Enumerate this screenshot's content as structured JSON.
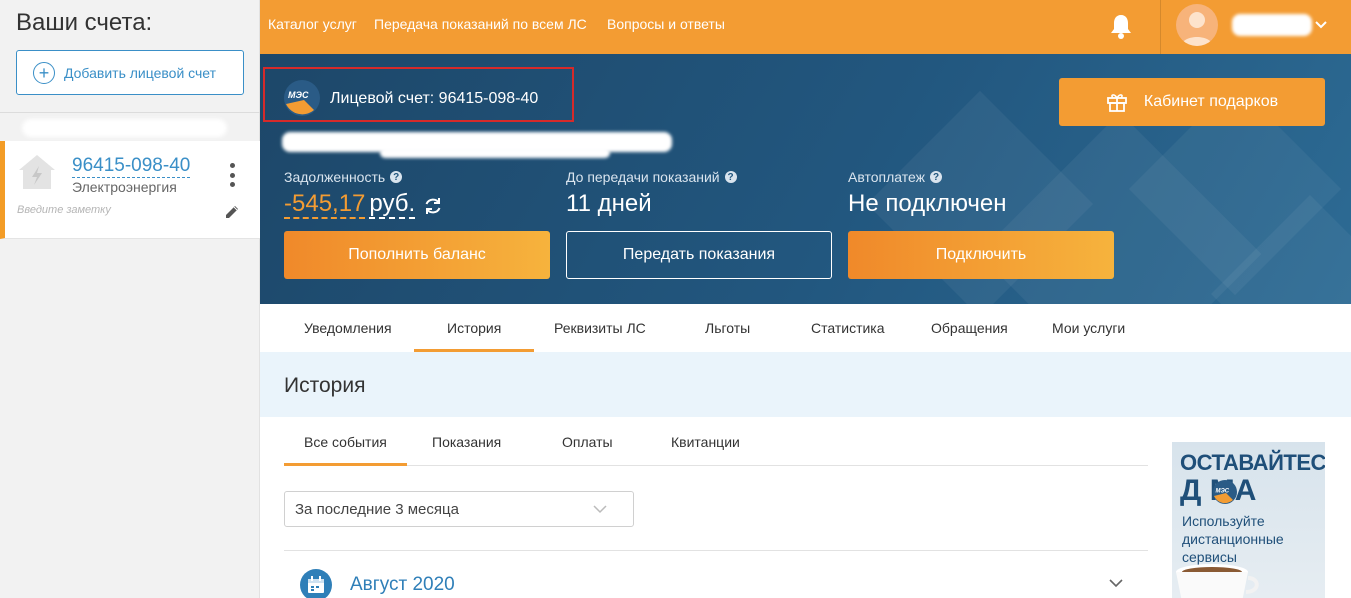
{
  "sidebar": {
    "title": "Ваши счета:",
    "add_button": "Добавить лицевой счет",
    "account": {
      "number": "96415-098-40",
      "type": "Электроэнергия",
      "note_placeholder": "Введите заметку"
    }
  },
  "topnav": {
    "links": [
      "Каталог услуг",
      "Передача показаний по всем ЛС",
      "Вопросы и ответы"
    ]
  },
  "hero": {
    "logo_text": "МЭС",
    "account_label": "Лицевой счет: 96415-098-40",
    "gift_button": "Кабинет подарков",
    "debt": {
      "label": "Задолженность",
      "value": "-545,17",
      "currency": "руб."
    },
    "readings": {
      "label": "До передачи показаний",
      "value": "11 дней"
    },
    "autopay": {
      "label": "Автоплатеж",
      "value": "Не подключен"
    },
    "buttons": {
      "topup": "Пополнить баланс",
      "submit": "Передать показания",
      "connect": "Подключить"
    }
  },
  "tabs": [
    "Уведомления",
    "История",
    "Реквизиты ЛС",
    "Льготы",
    "Статистика",
    "Обращения",
    "Мои услуги"
  ],
  "active_tab": "История",
  "history": {
    "title": "История",
    "subtabs": [
      "Все события",
      "Показания",
      "Оплаты",
      "Квитанции"
    ],
    "period": "За последние 3 месяца",
    "month": "Август 2020"
  },
  "promo": {
    "line1": "ОСТАВАЙТЕСЬ",
    "line2": "Д МА",
    "logo_text": "МЭС",
    "sub": [
      "Используйте",
      "дистанционные",
      "сервисы"
    ]
  },
  "colors": {
    "accent": "#f39c33",
    "hero": "#22577f",
    "link": "#3a8fc7",
    "highlight": "#d62a2a"
  }
}
